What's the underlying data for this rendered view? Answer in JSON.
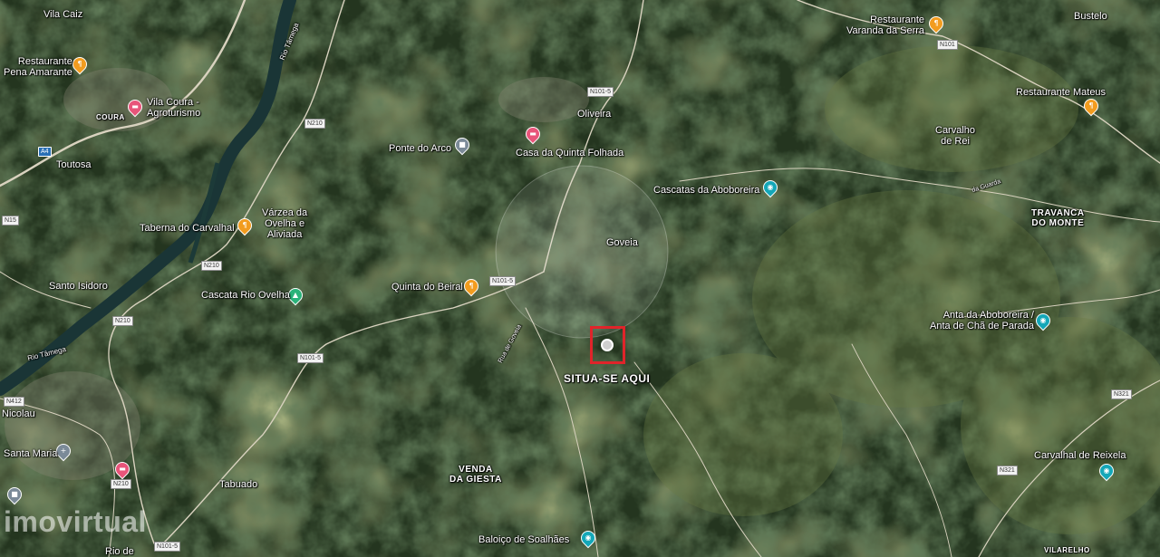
{
  "map": {
    "type": "satellite",
    "colors": {
      "vegetation_dark": "#1f2e1b",
      "vegetation_mid": "#2f4223",
      "vegetation_light": "#5b6d35",
      "river": "#1b3a3a",
      "road": "#d8d3c4",
      "highlight": "#e0242a"
    }
  },
  "marker": {
    "label": "SITUA-SE AQUI",
    "icon": "location-pin-icon"
  },
  "watermark": "imovirtual",
  "places": {
    "vila_caiz": "Vila Caiz",
    "restaurante_pena_amarante": "Restaurante\nPena Amarante",
    "vila_coura": "Vila Coura -\nAgroturismo",
    "coura": "COURA",
    "toutosa": "Toutosa",
    "taberna_carvalhal": "Taberna do Carvalhal",
    "varzea_ovelha": "Várzea da\nOvelha e\nAliviada",
    "santo_isidoro": "Santo Isidoro",
    "cascata_rio_ovelha": "Cascata Rio Ovelha",
    "rio_tamega_1": "Rio Tâmega",
    "rio_tamega_2": "Rio Tâmega",
    "nicolau": "Nicolau",
    "santa_maria": "Santa Maria",
    "tabuado": "Tabuado",
    "rio_de": "Rio de",
    "ponte_do_arco": "Ponte do Arco",
    "casa_quinta_folhada": "Casa da Quinta Folhada",
    "oliveira": "Oliveira",
    "cascatas_aboboreira": "Cascatas da Aboboreira",
    "goveia": "Goveia",
    "quinta_do_beiral": "Quinta do Beiral",
    "rua_goveia": "Rua de Goveia",
    "venda_da_giesta": "VENDA\nDA GIESTA",
    "baloico_soalhaes": "Baloiço de Soalhães",
    "restaurante_varanda": "Restaurante\nVaranda da Serra",
    "bustelo": "Bustelo",
    "restaurante_mateus": "Restaurante Mateus",
    "carvalho_de_rei": "Carvalho\nde Rei",
    "travanca_do_monte": "TRAVANCA\nDO MONTE",
    "anta_aboboreira": "Anta da Aboboreira /\nAnta de Chã de Parada",
    "carvalhal_reixela": "Carvalhal de Reixela",
    "vilarelho": "VILARELHO",
    "guarda": "da Guarda"
  },
  "roads": {
    "n210_a": "N210",
    "n210_b": "N210",
    "n210_c": "N210",
    "n210_d": "N210",
    "n101_5_a": "N101-5",
    "n101_5_b": "N101-5",
    "n101_5_c": "N101-5",
    "n101_5_d": "N101-5",
    "n101": "N101",
    "n321_a": "N321",
    "n321_b": "N321",
    "a4": "A4",
    "n15": "N15",
    "n412": "N412"
  },
  "icons": [
    "restaurant-icon",
    "hotel-icon",
    "park-icon",
    "landmark-icon",
    "waterfall-icon",
    "church-icon",
    "location-pin-icon"
  ]
}
